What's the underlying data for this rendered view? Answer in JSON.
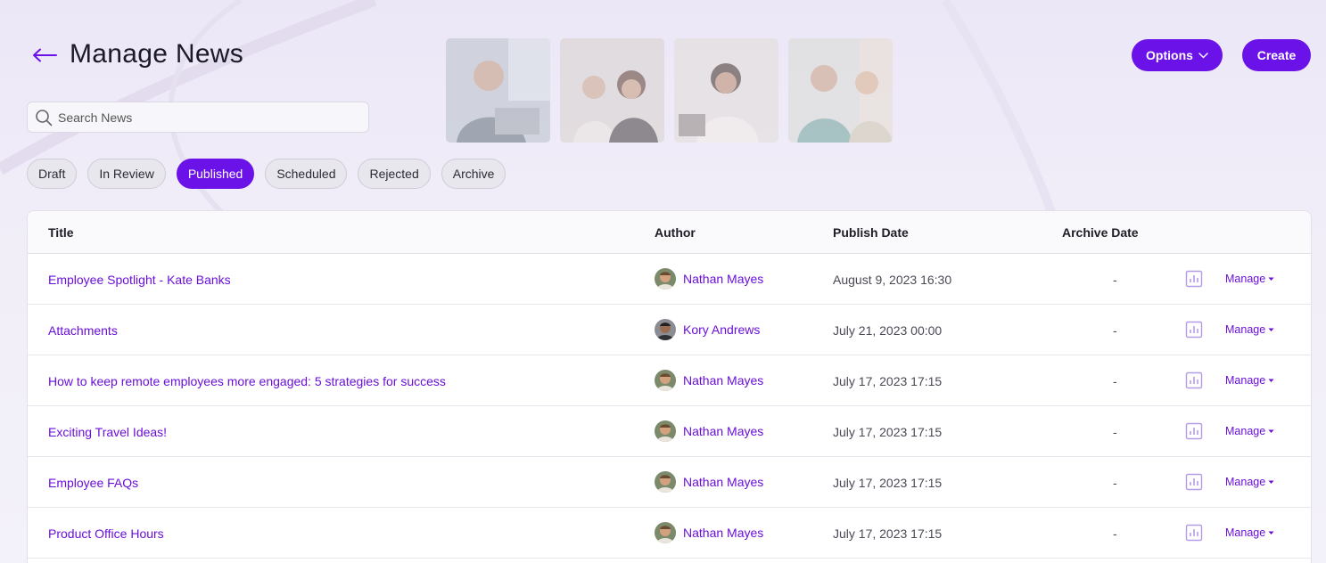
{
  "header": {
    "title": "Manage News",
    "back_icon": "arrow-left-icon",
    "search_placeholder": "Search News",
    "options_label": "Options",
    "create_label": "Create"
  },
  "colors": {
    "accent": "#6b12e8",
    "link": "#6a0fd9",
    "background": "#f1eff8"
  },
  "tabs": [
    {
      "label": "Draft",
      "active": false
    },
    {
      "label": "In Review",
      "active": false
    },
    {
      "label": "Published",
      "active": true
    },
    {
      "label": "Scheduled",
      "active": false
    },
    {
      "label": "Rejected",
      "active": false
    },
    {
      "label": "Archive",
      "active": false
    }
  ],
  "table": {
    "columns": [
      "Title",
      "Author",
      "Publish Date",
      "Archive Date"
    ],
    "manage_label": "Manage",
    "rows": [
      {
        "title": "Employee Spotlight - Kate Banks",
        "author": "Nathan Mayes",
        "publish_date": "August 9, 2023 16:30",
        "archive_date": "-"
      },
      {
        "title": "Attachments",
        "author": "Kory Andrews",
        "publish_date": "July 21, 2023 00:00",
        "archive_date": "-"
      },
      {
        "title": "How to keep remote employees more engaged: 5 strategies for success",
        "author": "Nathan Mayes",
        "publish_date": "July 17, 2023 17:15",
        "archive_date": "-"
      },
      {
        "title": "Exciting Travel Ideas!",
        "author": "Nathan Mayes",
        "publish_date": "July 17, 2023 17:15",
        "archive_date": "-"
      },
      {
        "title": "Employee FAQs",
        "author": "Nathan Mayes",
        "publish_date": "July 17, 2023 17:15",
        "archive_date": "-"
      },
      {
        "title": "Product Office Hours",
        "author": "Nathan Mayes",
        "publish_date": "July 17, 2023 17:15",
        "archive_date": "-"
      }
    ]
  }
}
